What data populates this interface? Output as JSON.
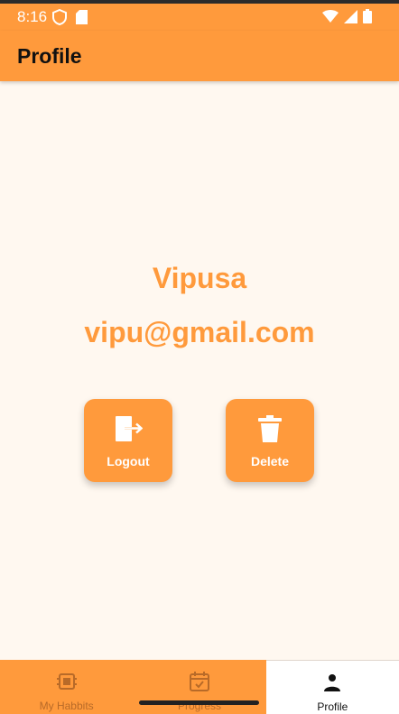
{
  "status_bar": {
    "time": "8:16",
    "left_icons": [
      "shield-icon",
      "sd-card-icon"
    ],
    "right_icons": [
      "wifi-icon",
      "signal-icon",
      "battery-icon"
    ]
  },
  "app_bar": {
    "title": "Profile"
  },
  "profile": {
    "name": "Vipusa",
    "email": "vipu@gmail.com"
  },
  "actions": {
    "logout": {
      "label": "Logout",
      "icon": "logout-icon"
    },
    "delete": {
      "label": "Delete",
      "icon": "trash-icon"
    }
  },
  "bottom_nav": {
    "items": [
      {
        "label": "My Habbits",
        "icon": "chip-icon",
        "active": false
      },
      {
        "label": "Progress",
        "icon": "calendar-check-icon",
        "active": false
      },
      {
        "label": "Profile",
        "icon": "person-icon",
        "active": true
      }
    ]
  },
  "colors": {
    "accent": "#ff9a3c",
    "background": "#fff8f0",
    "nav_inactive_text": "#b86a28",
    "active_text": "#111111"
  }
}
